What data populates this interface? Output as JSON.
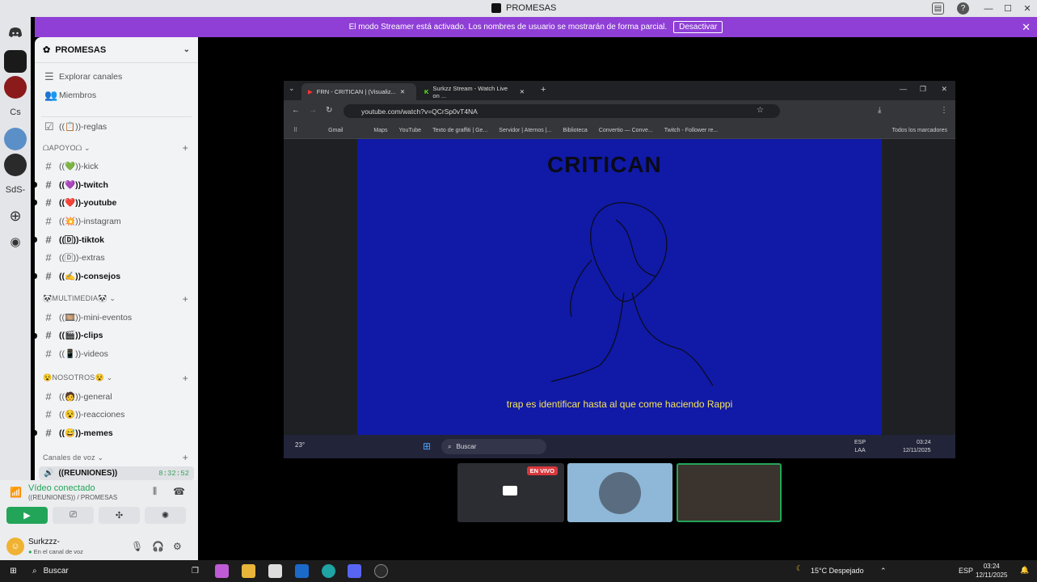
{
  "window": {
    "title": "PROMESAS"
  },
  "banner": {
    "text": "El modo Streamer está activado. Los nombres de usuario se mostrarán de forma parcial.",
    "button": "Desactivar"
  },
  "servers": {
    "items": [
      "Cs",
      "SdS-"
    ]
  },
  "guild": {
    "name": "PROMESAS"
  },
  "nav": {
    "explore": "Explorar canales",
    "members": "Miembros",
    "rules": "((📋))-reglas"
  },
  "categories": {
    "apoyo": "ᗝAPOYOᗝ",
    "multimedia": "🐼MULTIMEDIA🐼",
    "nosotros": "😵NOSOTROS😵",
    "voice": "Canales de voz"
  },
  "channels_apoyo": [
    "((💚))-kick",
    "((💜))-twitch",
    "((❤️))-youtube",
    "((💥))-instagram",
    "((🄳))-tiktok",
    "((🄳))-extras",
    "((✍️))-consejos"
  ],
  "channels_multimedia": [
    "((🎞️))-mini-eventos",
    "((🎬))-clips",
    "((📱))-videos"
  ],
  "channels_nosotros": [
    "((🧑))-general",
    "((😵))-reacciones",
    "((😅))-memes"
  ],
  "voice_channel": {
    "name": "((REUNIONES))",
    "time": "8:32:52"
  },
  "voice_panel": {
    "status": "Vídeo conectado",
    "location": "((REUNIONES)) / PROMESAS"
  },
  "user": {
    "name": "Surkzzz-",
    "status": "En el canal de voz"
  },
  "browser": {
    "tab1": "FRN - CRITICAN | (Visualiz...",
    "tab2": "Surkzz Stream - Watch Live on ...",
    "url": "youtube.com/watch?v=QCrSp0vT4NA",
    "bookmarks": [
      "Gmail",
      "Maps",
      "YouTube",
      "Texto de graffiti | Ge...",
      "Servidor | Aternos |...",
      "Biblioteca",
      "Convertio — Conve...",
      "Twitch - Follower re...",
      "Todos los marcadores"
    ]
  },
  "video": {
    "title": "CRITICAN",
    "subtitle": "trap es identificar hasta al que come haciendo Rappi"
  },
  "inner_taskbar": {
    "temp": "23°",
    "search": "Buscar",
    "lang1": "ESP",
    "lang2": "LAA",
    "time": "03:24",
    "date": "12/11/2025"
  },
  "stream": {
    "live_badge": "EN VIVO"
  },
  "taskbar": {
    "search": "Buscar",
    "weather": "15°C  Despejado",
    "lang": "ESP",
    "time": "03:24",
    "date": "12/11/2025"
  },
  "colors": {
    "banner": "#8f3fd6",
    "connected": "#23a559",
    "live": "#da373c",
    "video_bg": "#101aa6"
  }
}
